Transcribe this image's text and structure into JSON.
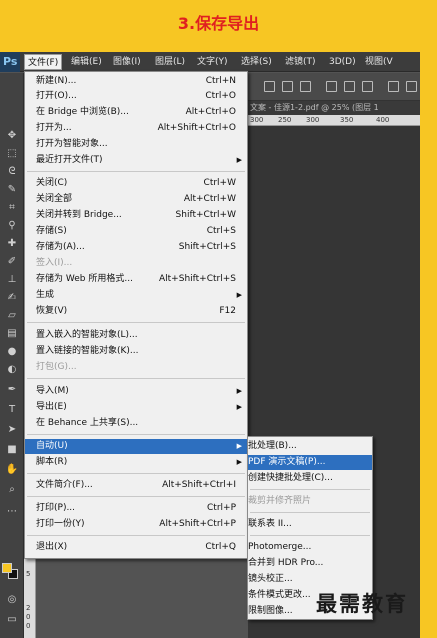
{
  "step_title": "3.保存导出",
  "app_logo": "Ps",
  "menubar": {
    "items": [
      "文件(F)",
      "编辑(E)",
      "图像(I)",
      "图层(L)",
      "文字(Y)",
      "选择(S)",
      "滤镜(T)",
      "3D(D)",
      "视图(V"
    ]
  },
  "document_tab": "文案 - 佳源1-2.pdf @ 25% (图层 1",
  "ruler_h_labels": [
    "300",
    "250",
    "300",
    "350",
    "400"
  ],
  "ruler_v_labels": [
    "1",
    "0",
    "0",
    "5",
    "2",
    "0",
    "0"
  ],
  "file_menu": {
    "items": [
      {
        "label": "新建(N)...",
        "shortcut": "Ctrl+N"
      },
      {
        "label": "打开(O)...",
        "shortcut": "Ctrl+O"
      },
      {
        "label": "在 Bridge 中浏览(B)...",
        "shortcut": "Alt+Ctrl+O"
      },
      {
        "label": "打开为...",
        "shortcut": "Alt+Shift+Ctrl+O"
      },
      {
        "label": "打开为智能对象...",
        "shortcut": ""
      },
      {
        "label": "最近打开文件(T)",
        "shortcut": ""
      },
      {
        "label": "关闭(C)",
        "shortcut": "Ctrl+W"
      },
      {
        "label": "关闭全部",
        "shortcut": "Alt+Ctrl+W"
      },
      {
        "label": "关闭并转到 Bridge...",
        "shortcut": "Shift+Ctrl+W"
      },
      {
        "label": "存储(S)",
        "shortcut": "Ctrl+S"
      },
      {
        "label": "存储为(A)...",
        "shortcut": "Shift+Ctrl+S"
      },
      {
        "label": "签入(I)...",
        "shortcut": ""
      },
      {
        "label": "存储为 Web 所用格式...",
        "shortcut": "Alt+Shift+Ctrl+S"
      },
      {
        "label": "生成",
        "shortcut": ""
      },
      {
        "label": "恢复(V)",
        "shortcut": "F12"
      },
      {
        "label": "置入嵌入的智能对象(L)...",
        "shortcut": ""
      },
      {
        "label": "置入链接的智能对象(K)...",
        "shortcut": ""
      },
      {
        "label": "打包(G)...",
        "shortcut": ""
      },
      {
        "label": "导入(M)",
        "shortcut": ""
      },
      {
        "label": "导出(E)",
        "shortcut": ""
      },
      {
        "label": "在 Behance 上共享(S)...",
        "shortcut": ""
      },
      {
        "label": "自动(U)",
        "shortcut": ""
      },
      {
        "label": "脚本(R)",
        "shortcut": ""
      },
      {
        "label": "文件简介(F)...",
        "shortcut": "Alt+Shift+Ctrl+I"
      },
      {
        "label": "打印(P)...",
        "shortcut": "Ctrl+P"
      },
      {
        "label": "打印一份(Y)",
        "shortcut": "Alt+Shift+Ctrl+P"
      },
      {
        "label": "退出(X)",
        "shortcut": "Ctrl+Q"
      }
    ]
  },
  "automate_submenu": {
    "items": [
      "批处理(B)...",
      "PDF 演示文稿(P)...",
      "创建快捷批处理(C)...",
      "裁剪并修齐照片",
      "联系表 II...",
      "Photomerge...",
      "合并到 HDR Pro...",
      "镜头校正...",
      "条件模式更改...",
      "限制图像..."
    ]
  },
  "watermark": "最需教育",
  "colors": {
    "background": "#f7c623",
    "title": "#e02020",
    "highlight": "#2d6fbf",
    "foreground_swatch": "#f7c623",
    "background_swatch": "#111111"
  }
}
